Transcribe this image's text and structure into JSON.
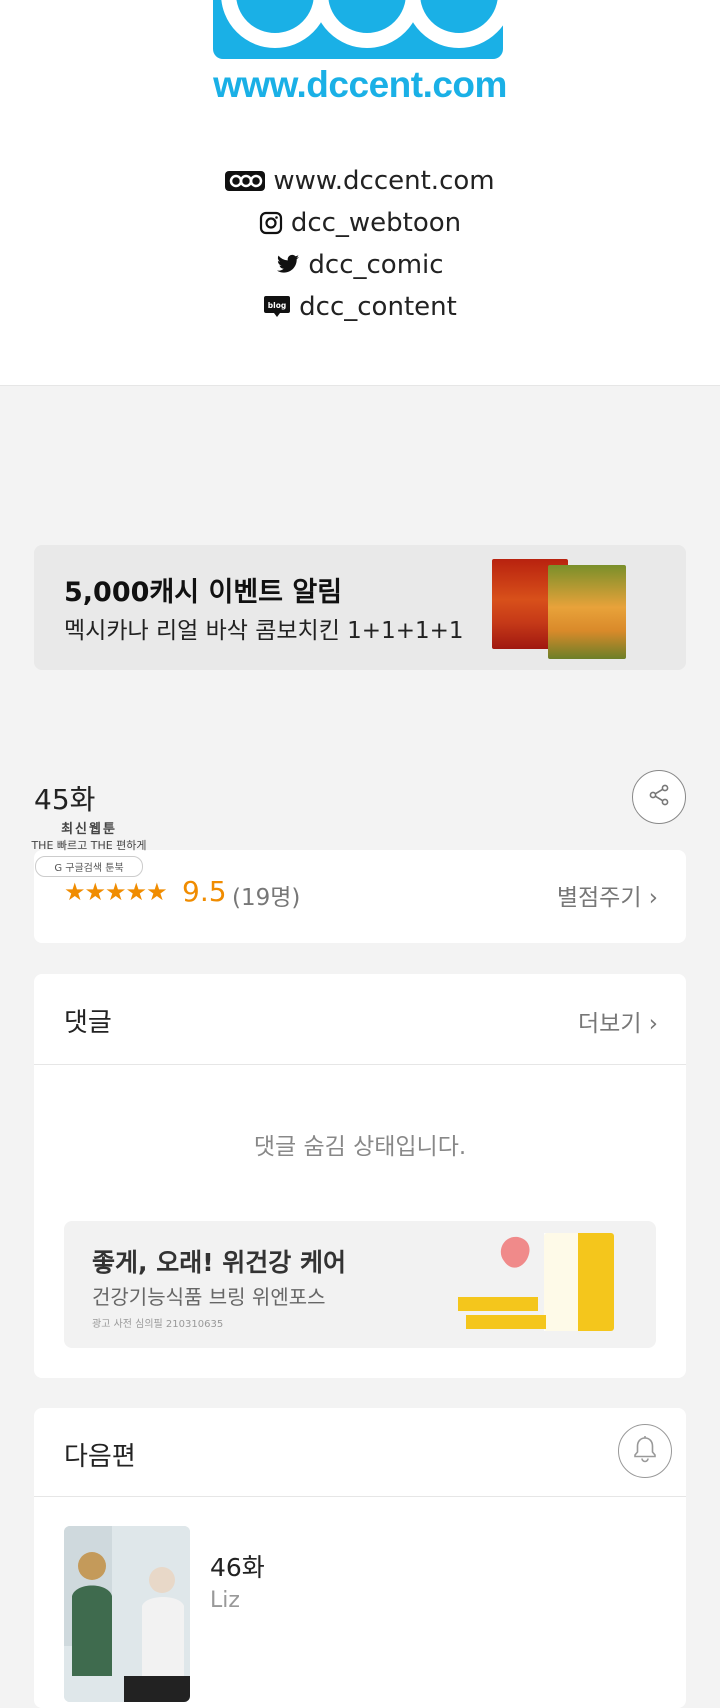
{
  "header": {
    "logo_url_text": "www.dccent.com",
    "social": [
      {
        "icon": "dcc-logo-icon",
        "label": "www.dccent.com"
      },
      {
        "icon": "instagram-icon",
        "label": "dcc_webtoon"
      },
      {
        "icon": "twitter-icon",
        "label": "dcc_comic"
      },
      {
        "icon": "blog-icon",
        "label": "dcc_content"
      }
    ]
  },
  "banner": {
    "title": "5,000캐시 이벤트 알림",
    "subtitle": "멕시카나 리얼 바삭 콤보치킨 1+1+1+1"
  },
  "episode": {
    "title": "45화",
    "share_icon": "share-icon"
  },
  "watermark": {
    "line1": "최신웹툰",
    "line2": "THE 빠르고 THE 편하게",
    "line3": "G 구글검색   툰북"
  },
  "rating": {
    "stars": "★★★★★",
    "score": "9.5",
    "count": "(19명)",
    "rate_label": "별점주기 ›",
    "color": "#f08c00"
  },
  "comments": {
    "heading": "댓글",
    "more_label": "더보기 ›",
    "hidden_message": "댓글 숨김 상태입니다.",
    "ad": {
      "title": "좋게, 오래! 위건강 케어",
      "subtitle": "건강기능식품 브링 위엔포스",
      "notice": "광고 사전 심의필 210310635"
    }
  },
  "next": {
    "heading": "다음편",
    "bell_icon": "bell-icon",
    "episode_title": "46화",
    "author": "Liz"
  }
}
